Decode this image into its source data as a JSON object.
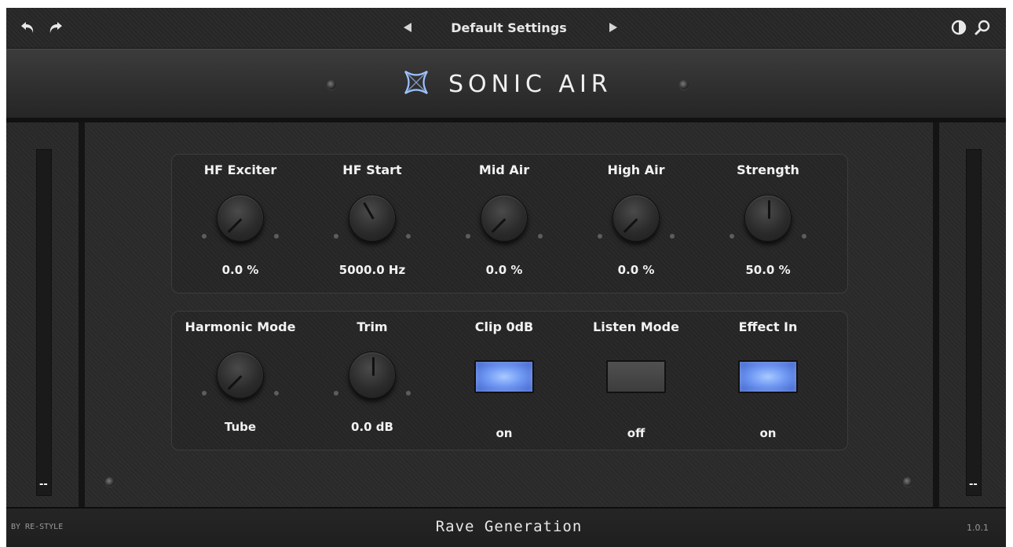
{
  "toolbar": {
    "undo_icon": "undo-arrow-icon",
    "redo_icon": "redo-arrow-icon",
    "prev_icon": "triangle-left-icon",
    "next_icon": "triangle-right-icon",
    "preset_name": "Default Settings",
    "contrast_icon": "half-circle-icon",
    "zoom_icon": "magnifier-icon"
  },
  "header": {
    "title": "SONIC AIR",
    "logo_icon": "sonic-air-logo-icon"
  },
  "meters": {
    "left_readout": "--",
    "right_readout": "--"
  },
  "top_group": [
    {
      "label": "HF Exciter",
      "value": "0.0 %",
      "angle": -135
    },
    {
      "label": "HF Start",
      "value": "5000.0 Hz",
      "angle": -30
    },
    {
      "label": "Mid Air",
      "value": "0.0 %",
      "angle": -135
    },
    {
      "label": "High Air",
      "value": "0.0 %",
      "angle": -135
    },
    {
      "label": "Strength",
      "value": "50.0 %",
      "angle": 0
    }
  ],
  "bottom_group": {
    "harmonic_mode": {
      "label": "Harmonic Mode",
      "value": "Tube",
      "angle": -135
    },
    "trim": {
      "label": "Trim",
      "value": "0.0 dB",
      "angle": 0
    },
    "clip": {
      "label": "Clip 0dB",
      "value": "on",
      "state": "on"
    },
    "listen": {
      "label": "Listen Mode",
      "value": "off",
      "state": "off"
    },
    "effect": {
      "label": "Effect In",
      "value": "on",
      "state": "on"
    }
  },
  "footer": {
    "credit": "BY RE-STYLE",
    "brand": "Rave Generation",
    "version": "1.0.1"
  },
  "colors": {
    "switch_on": "#6f98f3",
    "logo_blue": "#9ec2ff"
  }
}
